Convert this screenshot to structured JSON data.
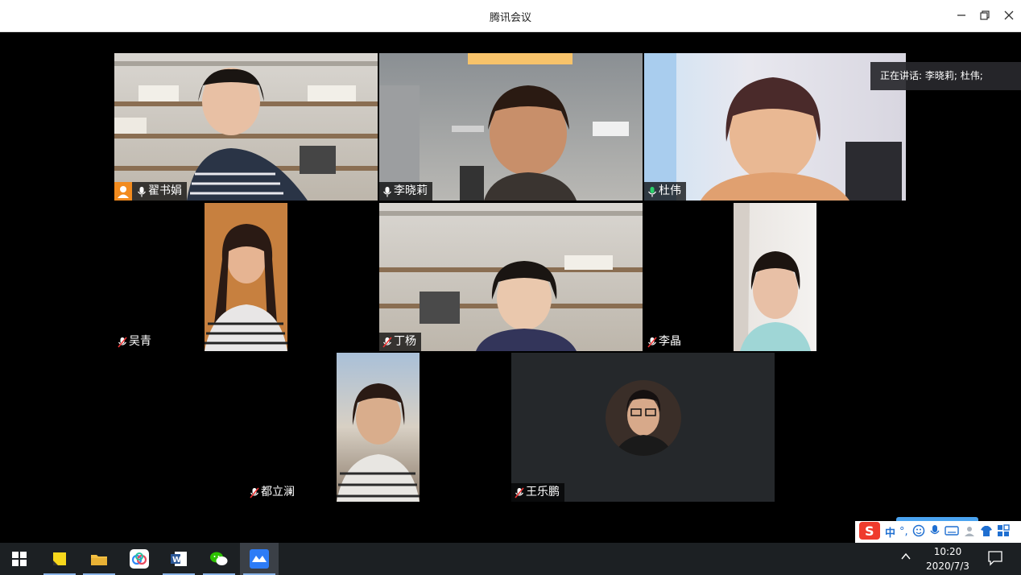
{
  "window": {
    "title": "腾讯会议",
    "min_icon": "minimize-icon",
    "restore_icon": "restore-icon",
    "close_icon": "close-icon"
  },
  "speaking": {
    "text": "正在讲话: 李晓莉; 杜伟;"
  },
  "participants": [
    {
      "name": "翟书娟",
      "mic": "mic-on",
      "host": true,
      "video": "bookshelf"
    },
    {
      "name": "李晓莉",
      "mic": "mic-on",
      "speaking": true,
      "video": "room"
    },
    {
      "name": "杜伟",
      "mic": "mic-on",
      "video": "bright-room"
    },
    {
      "name": "吴青",
      "mic": "mic-muted",
      "video": "portrait"
    },
    {
      "name": "丁杨",
      "mic": "mic-muted",
      "video": "bookshelf"
    },
    {
      "name": "李晶",
      "mic": "mic-muted",
      "video": "portrait"
    },
    {
      "name": "都立澜",
      "mic": "mic-muted",
      "video": "portrait-sky"
    },
    {
      "name": "王乐鹏",
      "mic": "mic-muted",
      "video": "avatar"
    }
  ],
  "ime": {
    "lang_label": "中",
    "punct_label": "°,",
    "brand": "sogou"
  },
  "taskbar": {
    "apps": [
      "windows-start-icon",
      "sticky-notes-icon",
      "file-explorer-icon",
      "baidu-netdisk-icon",
      "word-icon",
      "wechat-icon",
      "tencent-meeting-icon"
    ],
    "time": "10:20",
    "date": "2020/7/3"
  },
  "colors": {
    "speaker_border": "#2ad06a",
    "host_badge": "#f28b1e",
    "taskbar": "#1c2023"
  }
}
